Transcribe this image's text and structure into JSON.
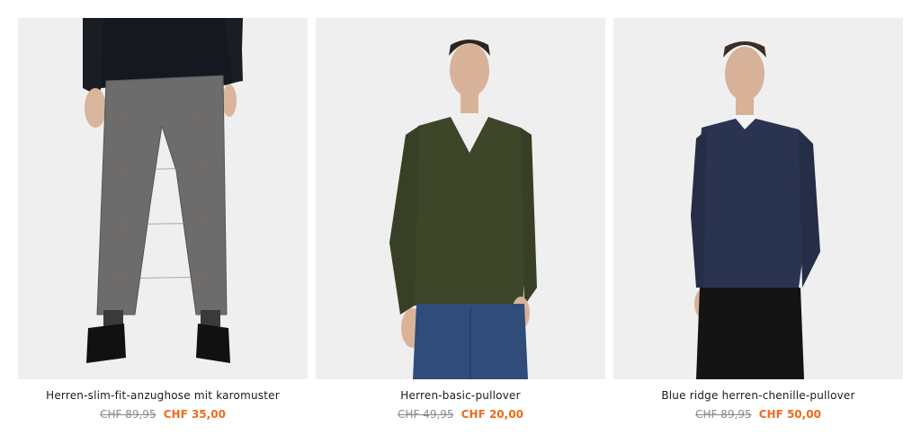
{
  "products": [
    {
      "title": "Herren-slim-fit-anzughose mit karomuster",
      "old_price": "CHF 89,95",
      "new_price": "CHF 35,00"
    },
    {
      "title": "Herren-basic-pullover",
      "old_price": "CHF 49,95",
      "new_price": "CHF 20,00"
    },
    {
      "title": "Blue ridge herren-chenille-pullover",
      "old_price": "CHF 89,95",
      "new_price": "CHF 50,00"
    }
  ],
  "colors": {
    "image_background": "#efefef",
    "sale_price": "#ef6a1b",
    "old_price": "#8a8a8a"
  }
}
